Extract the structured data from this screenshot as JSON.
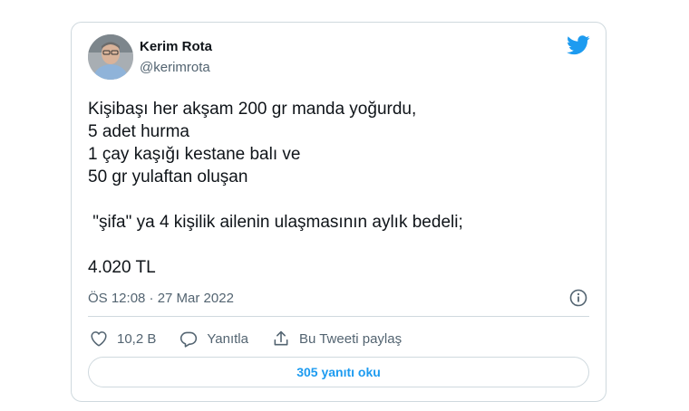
{
  "author": {
    "name": "Kerim Rota",
    "handle": "@kerimrota",
    "avatar_icon": "user-avatar"
  },
  "tweet": {
    "lines": [
      "Kişibaşı her akşam 200 gr manda yoğurdu,",
      "5 adet hurma",
      "1 çay kaşığı kestane balı ve",
      "50 gr yulaftan oluşan",
      "",
      " \"şifa\" ya 4 kişilik ailenin ulaşmasının aylık bedeli;",
      "",
      "4.020 TL"
    ],
    "timestamp": "ÖS 12:08 · 27 Mar 2022"
  },
  "actions": {
    "like_count": "10,2 B",
    "reply_label": "Yanıtla",
    "share_label": "Bu Tweeti paylaş"
  },
  "replies_button": "305 yanıtı oku",
  "colors": {
    "accent": "#1d9bf0",
    "text": "#0f1419",
    "muted": "#536471",
    "border": "#cfd9de"
  },
  "icons": [
    "twitter-logo-icon",
    "info-icon",
    "heart-icon",
    "reply-bubble-icon",
    "share-icon"
  ]
}
